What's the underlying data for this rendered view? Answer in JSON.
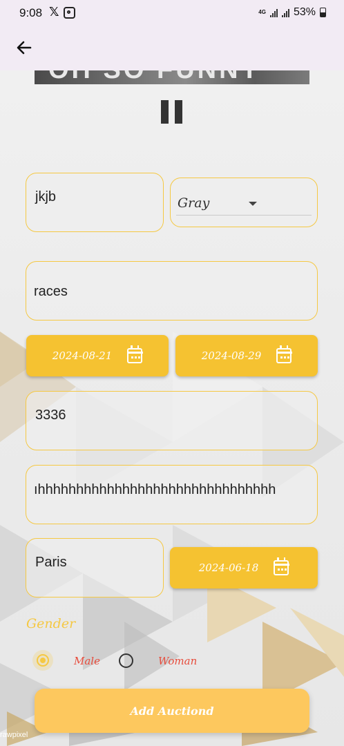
{
  "status_bar": {
    "time": "9:08",
    "x_icon": "x-logo-icon",
    "network": "4G",
    "battery": "53%"
  },
  "app_bar": {
    "back_icon": "arrow-left-icon"
  },
  "media": {
    "banner_text": "OH SO FUNNY",
    "control_icon": "pause-icon"
  },
  "form": {
    "name_value": "jkjb",
    "color_select": {
      "selected": "Gray"
    },
    "category_value": "races",
    "start_date": "2024-08-21",
    "end_date": "2024-08-29",
    "price_value": "3336",
    "description_value": "ıhhhhhhhhhhhhhhhhhhhhhhhhhhhhhhh",
    "city_value": "Paris",
    "birth_date": "2024-06-18",
    "gender": {
      "label": "Gender",
      "options": [
        "Male",
        "Woman"
      ],
      "selected": "Male"
    },
    "submit_label": "Add Auctiond"
  },
  "watermark": "rawpixel",
  "colors": {
    "accent": "#f5c842",
    "button": "#f5c231",
    "submit": "#fdc85e",
    "option_text": "#e74c3c",
    "app_bar": "#f2ebf4"
  }
}
